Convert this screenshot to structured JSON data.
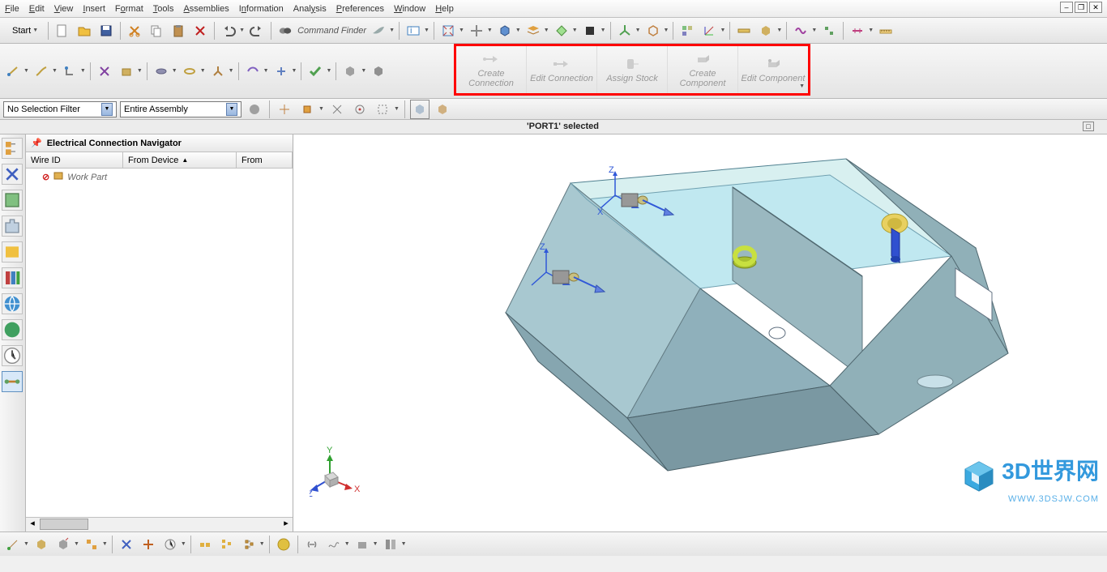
{
  "menu": {
    "file": "File",
    "edit": "Edit",
    "view": "View",
    "insert": "Insert",
    "format": "Format",
    "tools": "Tools",
    "assemblies": "Assemblies",
    "information": "Information",
    "analysis": "Analysis",
    "preferences": "Preferences",
    "window": "Window",
    "help": "Help"
  },
  "toolbar1": {
    "start": "Start",
    "command_finder": "Command Finder"
  },
  "routing_group": {
    "create_conn": "Create Connection",
    "edit_conn": "Edit Connection",
    "assign_stock": "Assign Stock",
    "create_comp": "Create Component",
    "edit_comp": "Edit Component"
  },
  "filters": {
    "selection": "No Selection Filter",
    "scope": "Entire Assembly"
  },
  "status": "'PORT1' selected",
  "navigator": {
    "title": "Electrical Connection Navigator",
    "cols": {
      "wire_id": "Wire ID",
      "from_device": "From Device",
      "from": "From"
    },
    "row1": "Work Part"
  },
  "watermark": {
    "text": "3D世界网",
    "url": "WWW.3DSJW.COM"
  },
  "axes": {
    "x": "X",
    "y": "Y",
    "z": "Z"
  }
}
